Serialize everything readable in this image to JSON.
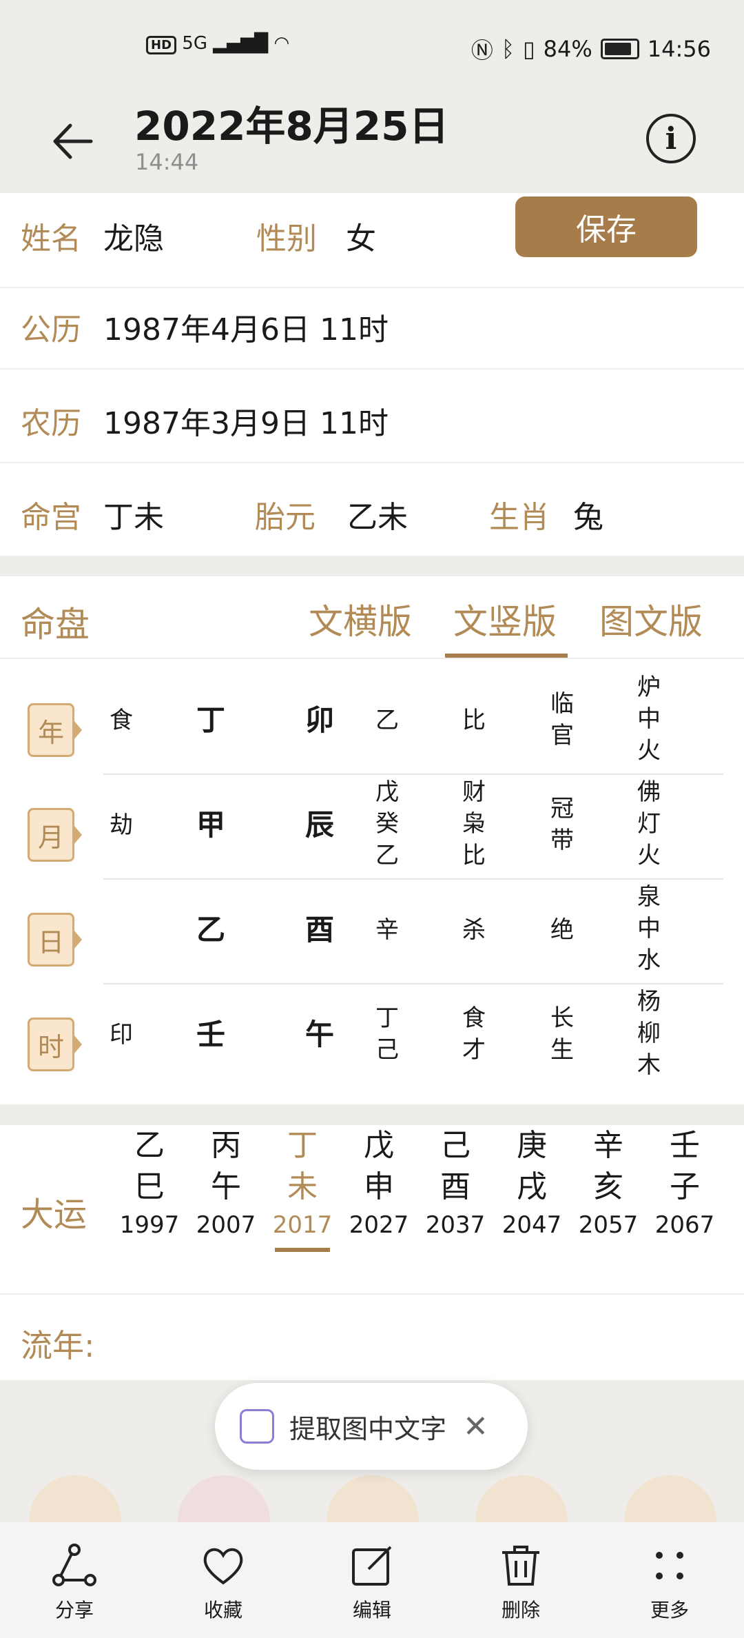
{
  "status_bar": {
    "network": "5G",
    "battery": "84%",
    "time": "14:56"
  },
  "header": {
    "title": "2022年8月25日",
    "subtitle": "14:44"
  },
  "profile": {
    "name_label": "姓名",
    "name": "龙隐",
    "gender_label": "性别",
    "gender": "女",
    "save_label": "保存",
    "solar_label": "公历",
    "solar": "1987年4月6日 11时",
    "lunar_label": "农历",
    "lunar": "1987年3月9日 11时",
    "minggong_label": "命宫",
    "minggong": "丁未",
    "taiyuan_label": "胎元",
    "taiyuan": "乙未",
    "zodiac_label": "生肖",
    "zodiac": "兔"
  },
  "chart": {
    "title": "命盘",
    "tabs": [
      {
        "label": "文横版"
      },
      {
        "label": "文竖版"
      },
      {
        "label": "图文版"
      }
    ],
    "rows": [
      {
        "pillar": "年",
        "shishen": "食",
        "stem": "丁",
        "branch": "卯",
        "hidden": "乙",
        "hidden_shishen": "比",
        "stage": "临\n官",
        "nayin": "炉\n中\n火"
      },
      {
        "pillar": "月",
        "shishen": "劫",
        "stem": "甲",
        "branch": "辰",
        "hidden": "戊\n癸\n乙",
        "hidden_shishen": "财\n枭\n比",
        "stage": "冠\n带",
        "nayin": "佛\n灯\n火"
      },
      {
        "pillar": "日",
        "shishen": "",
        "stem": "乙",
        "branch": "酉",
        "hidden": "辛",
        "hidden_shishen": "杀",
        "stage": "绝",
        "nayin": "泉\n中\n水"
      },
      {
        "pillar": "时",
        "shishen": "印",
        "stem": "壬",
        "branch": "午",
        "hidden": "丁\n己",
        "hidden_shishen": "食\n才",
        "stage": "长\n生",
        "nayin": "杨\n柳\n木"
      }
    ]
  },
  "dayun": {
    "label": "大运",
    "items": [
      {
        "stem": "乙",
        "branch": "巳",
        "year": "1997"
      },
      {
        "stem": "丙",
        "branch": "午",
        "year": "2007"
      },
      {
        "stem": "丁",
        "branch": "未",
        "year": "2017"
      },
      {
        "stem": "戊",
        "branch": "申",
        "year": "2027"
      },
      {
        "stem": "己",
        "branch": "酉",
        "year": "2037"
      },
      {
        "stem": "庚",
        "branch": "戌",
        "year": "2047"
      },
      {
        "stem": "辛",
        "branch": "亥",
        "year": "2057"
      },
      {
        "stem": "壬",
        "branch": "子",
        "year": "2067"
      }
    ]
  },
  "liunian": {
    "label": "流年:"
  },
  "ocr_bubble": {
    "label": "提取图中文字"
  },
  "toolbar": [
    {
      "label": "分享"
    },
    {
      "label": "收藏"
    },
    {
      "label": "编辑"
    },
    {
      "label": "删除"
    },
    {
      "label": "更多"
    }
  ]
}
